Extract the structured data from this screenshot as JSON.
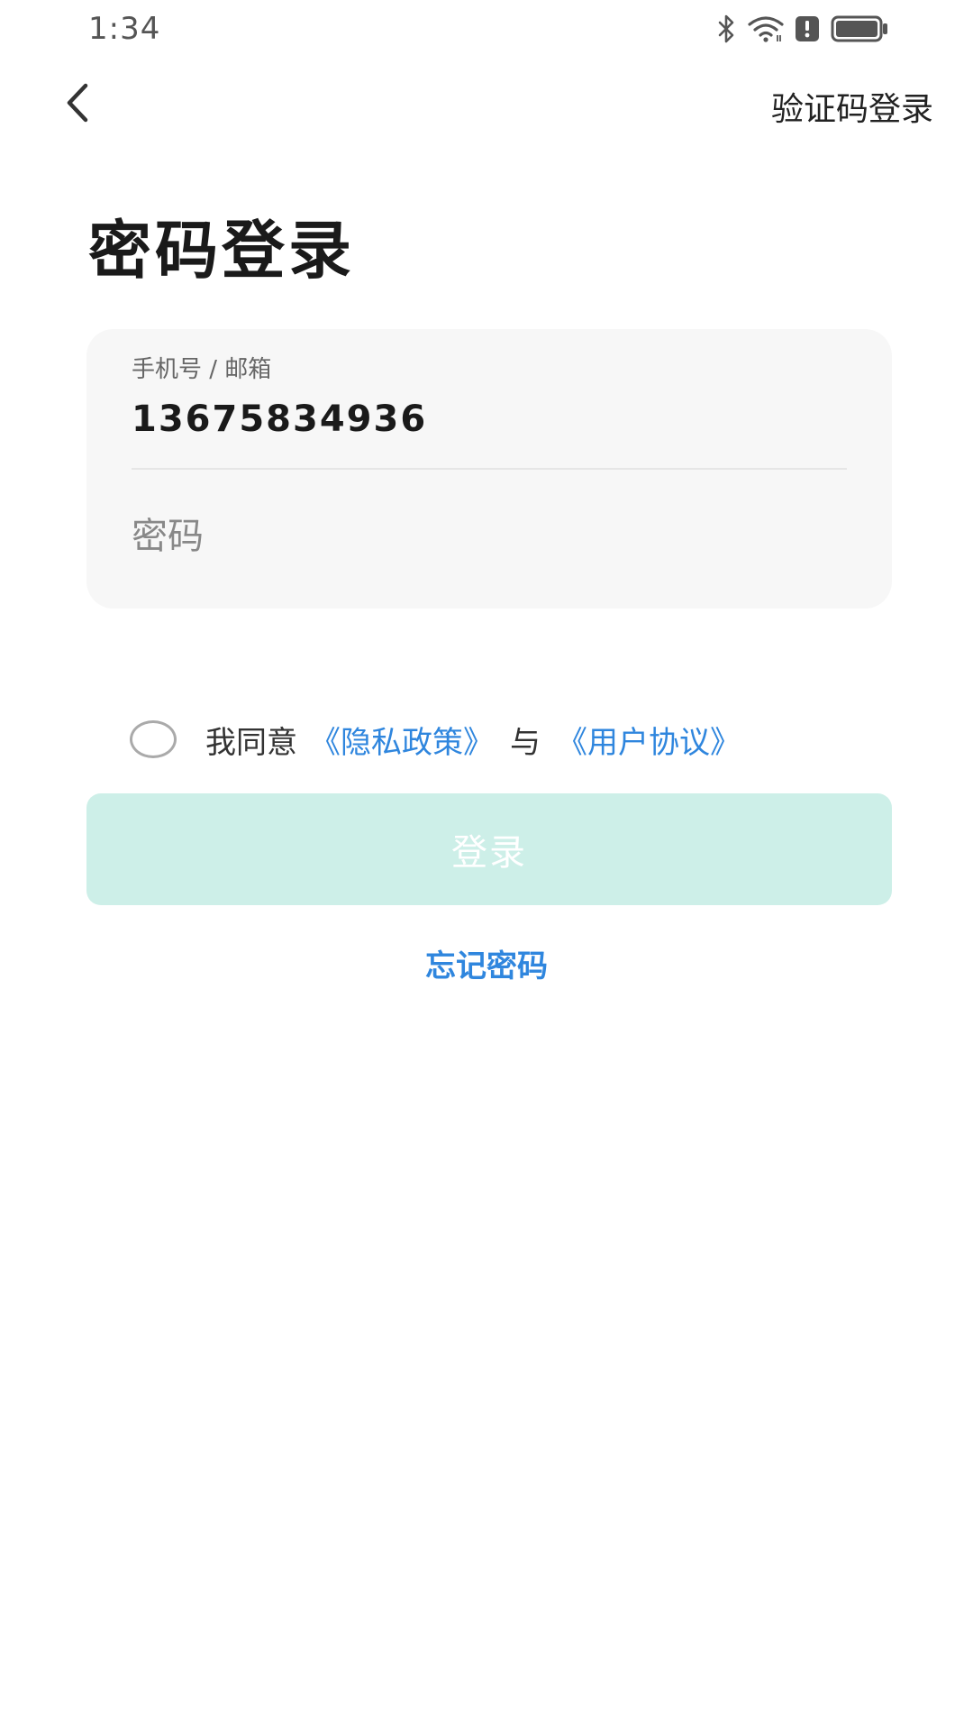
{
  "status_bar": {
    "time": "1:34",
    "icons": [
      "bluetooth-icon",
      "wifi-icon",
      "alert-notification-icon",
      "battery-icon"
    ]
  },
  "header": {
    "back_icon": "chevron-left-icon",
    "switch_login_label": "验证码登录"
  },
  "page": {
    "title": "密码登录"
  },
  "form": {
    "account_label": "手机号 / 邮箱",
    "account_value": "13675834936",
    "password_placeholder": "密码"
  },
  "agreement": {
    "agree_text": "我同意",
    "privacy_link": "《隐私政策》",
    "and_text": "与",
    "terms_link": "《用户协议》",
    "checked": false
  },
  "actions": {
    "login_label": "登录",
    "forgot_password_label": "忘记密码"
  },
  "colors": {
    "accent_link": "#2f86de",
    "login_button_disabled": "#cdefe8",
    "card_background": "#f7f7f7"
  }
}
